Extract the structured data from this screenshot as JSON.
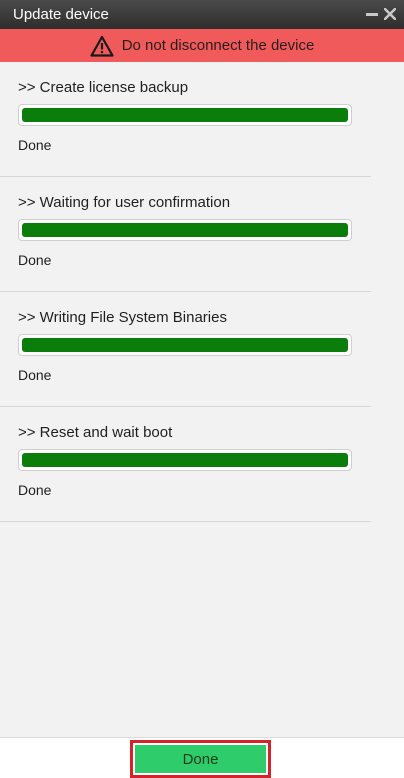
{
  "window": {
    "title": "Update device",
    "minimize_icon": "minimize-icon",
    "close_icon": "close-icon"
  },
  "warning": {
    "icon": "warning-triangle-icon",
    "text": "Do not disconnect the device",
    "color": "#f05a5a"
  },
  "steps": [
    {
      "title": ">> Create license backup",
      "progress": 1.0,
      "status": "Done"
    },
    {
      "title": ">> Waiting for user confirmation",
      "progress": 1.0,
      "status": "Done"
    },
    {
      "title": ">> Writing File System Binaries",
      "progress": 1.0,
      "status": "Done"
    },
    {
      "title": ">> Reset and wait boot",
      "progress": 1.0,
      "status": "Done"
    }
  ],
  "footer": {
    "done_label": "Done"
  },
  "colors": {
    "progress_fill": "#0a7d0a",
    "done_button": "#2ecc6a",
    "highlight_border": "#d6232a"
  }
}
